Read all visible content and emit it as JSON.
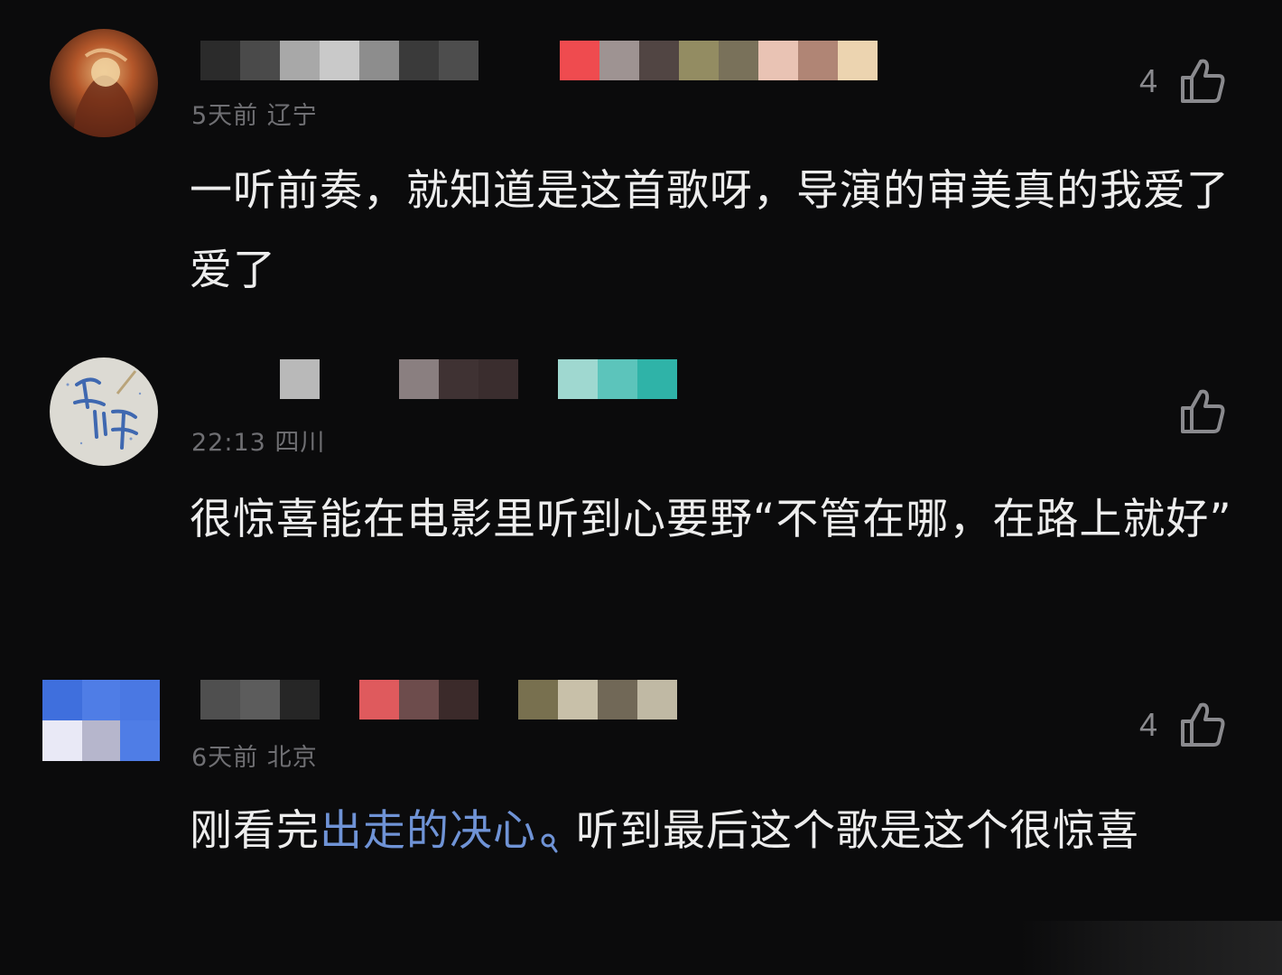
{
  "comments": [
    {
      "meta": "5天前 辽宁",
      "likes": "4",
      "text": "一听前奏，就知道是这首歌呀，导演的审美真的我爱了爱了",
      "avatar_colors": [
        "#3a1a10",
        "#b4572a",
        "#e0b070"
      ],
      "name_blocks": [
        "#2b2b2b",
        "#4a4a4a",
        "#a8a8a8",
        "#c9c9c9",
        "#8d8d8d",
        "#3a3a3a",
        "#4d4d4d",
        "",
        "",
        "#ef4b4f",
        "#9e9392",
        "#514543",
        "#938c62",
        "#79715a",
        "#e9c3b4",
        "#b08575",
        "#ecd4b0"
      ]
    },
    {
      "meta": "22:13 四川",
      "likes": "",
      "text": "很惊喜能在电影里听到心要野“不管在哪，在路上就好”",
      "avatar_colors": [
        "#d9d7d0",
        "#4a6fb0"
      ],
      "name_blocks": [
        "",
        "",
        "#b9b9b9",
        "",
        "",
        "#8a7f80",
        "#3f3233",
        "#3a2d2e",
        "",
        "#9fd8d0",
        "#5cc4bb",
        "#2fb3a8"
      ]
    },
    {
      "meta": "6天前 北京",
      "likes": "4",
      "text_before": "刚看完",
      "link": "出走的决心",
      "text_after": "听到最后这个歌是这个很惊喜",
      "avatar_colors": [
        "#4f7de6",
        "#e9e9f6",
        "#b6b6cc"
      ],
      "name_blocks": [
        "#4f4f4f",
        "#5c5c5c",
        "#262626",
        "",
        "#df5a5d",
        "#6d4c4c",
        "#3b2a2a",
        "",
        "#78704f",
        "#c8c0a9",
        "#716857",
        "#c0b9a4"
      ]
    }
  ],
  "icons": {
    "like": "thumbs-up-icon",
    "search": "search-icon"
  },
  "colors": {
    "background": "#0b0b0c",
    "text": "#ededed",
    "meta": "#6f6f73",
    "link": "#6f93d6"
  }
}
